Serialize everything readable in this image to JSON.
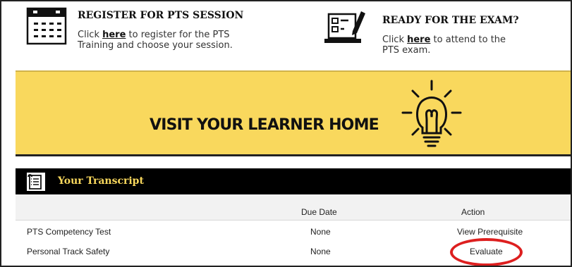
{
  "register": {
    "title": "REGISTER FOR PTS SESSION",
    "pre": "Click ",
    "link": "here",
    "post": " to register for the PTS Training and choose your session."
  },
  "exam": {
    "title": "READY FOR THE EXAM?",
    "pre": "Click ",
    "link": "here",
    "post": " to attend to the PTS exam."
  },
  "banner": {
    "label": "VISIT YOUR LEARNER HOME"
  },
  "transcript": {
    "title": "Your Transcript",
    "columns": {
      "due_date": "Due Date",
      "action": "Action"
    },
    "rows": [
      {
        "name": "PTS Competency Test",
        "due": "None",
        "action": "View Prerequisite"
      },
      {
        "name": "Personal Track Safety",
        "due": "None",
        "action": "Evaluate"
      }
    ]
  },
  "colors": {
    "banner_yellow": "#f9d85d",
    "header_black": "#000000",
    "highlight_red": "#dd1f1f"
  }
}
